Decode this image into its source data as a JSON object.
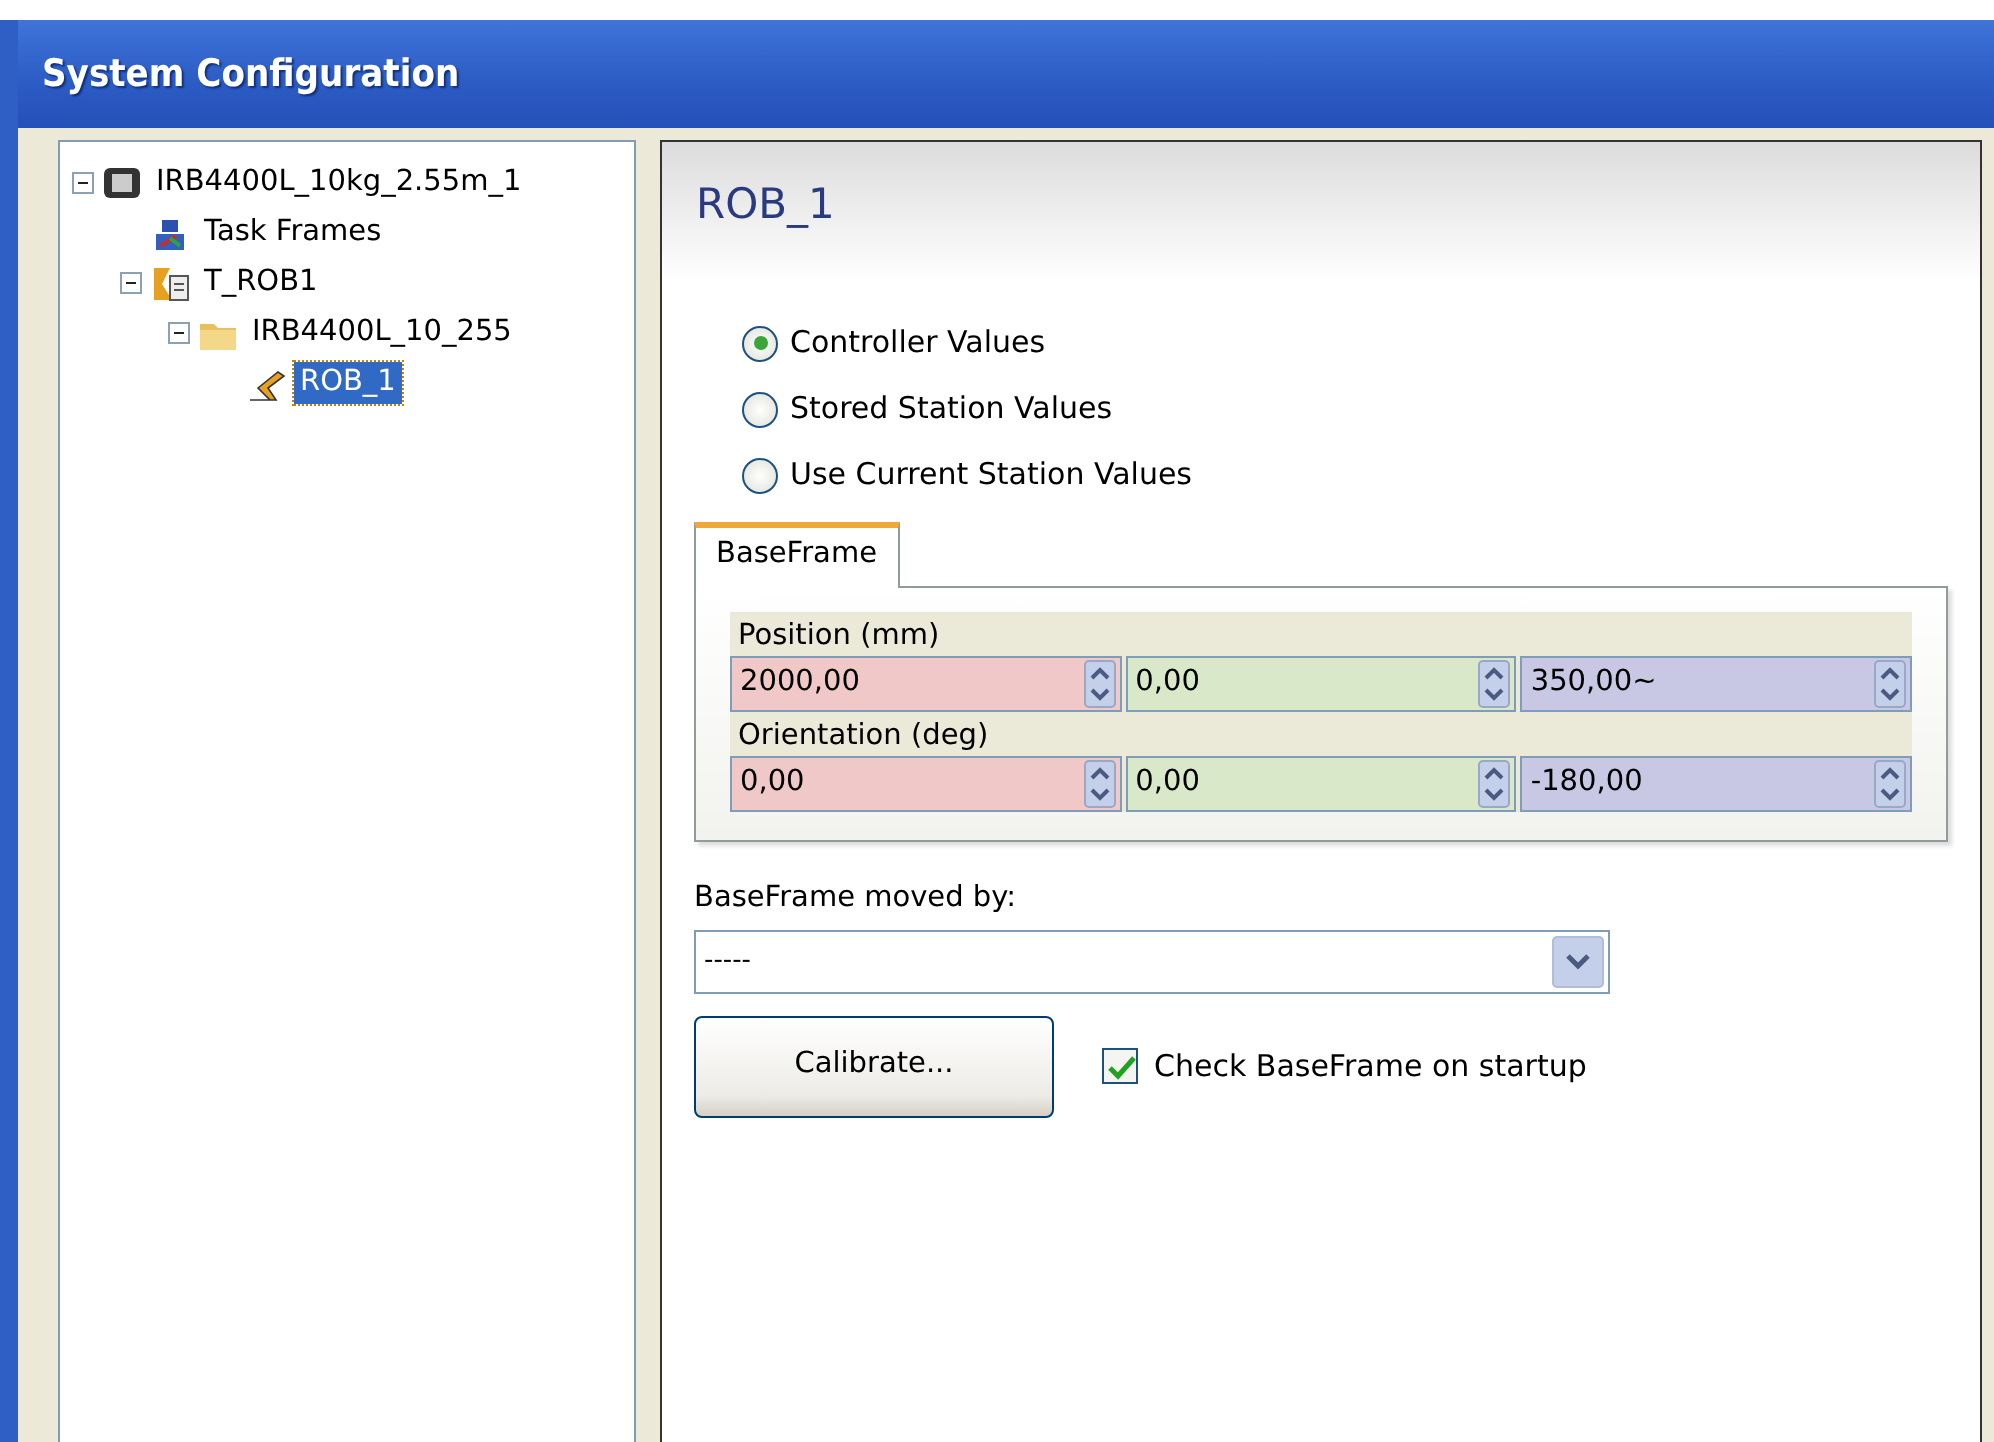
{
  "window": {
    "title": "System Configuration"
  },
  "tree": [
    {
      "label": "IRB4400L_10kg_2.55m_1",
      "kind": "system",
      "expanded": true,
      "selected": false,
      "children": [
        {
          "label": "Task Frames",
          "kind": "frames",
          "selected": false
        },
        {
          "label": "T_ROB1",
          "kind": "task",
          "expanded": true,
          "selected": false,
          "children": [
            {
              "label": "IRB4400L_10_255",
              "kind": "folder",
              "expanded": true,
              "selected": false,
              "children": [
                {
                  "label": "ROB_1",
                  "kind": "robot",
                  "selected": true
                }
              ]
            }
          ]
        }
      ]
    }
  ],
  "panel": {
    "title": "ROB_1",
    "options": [
      {
        "label": "Controller Values",
        "selected": true
      },
      {
        "label": "Stored Station Values",
        "selected": false
      },
      {
        "label": "Use Current Station Values",
        "selected": false
      }
    ],
    "tabs": [
      {
        "label": "BaseFrame",
        "selected": true
      }
    ],
    "groups": [
      {
        "label": "Position (mm)",
        "fields": [
          {
            "value": "2000,00",
            "color": "#f0c8c8"
          },
          {
            "value": "0,00",
            "color": "#d8e8c8"
          },
          {
            "value": "350,00~",
            "color": "#c8c8e4"
          }
        ]
      },
      {
        "label": "Orientation (deg)",
        "fields": [
          {
            "value": "0,00",
            "color": "#f0c8c8"
          },
          {
            "value": "0,00",
            "color": "#d8e8c8"
          },
          {
            "value": "-180,00",
            "color": "#c8c8e4"
          }
        ]
      }
    ],
    "moved_by": {
      "label": "BaseFrame moved by:",
      "value": "-----"
    },
    "calibrate_button": "Calibrate...",
    "check_on_startup": {
      "label": "Check BaseFrame on startup",
      "checked": true
    }
  }
}
